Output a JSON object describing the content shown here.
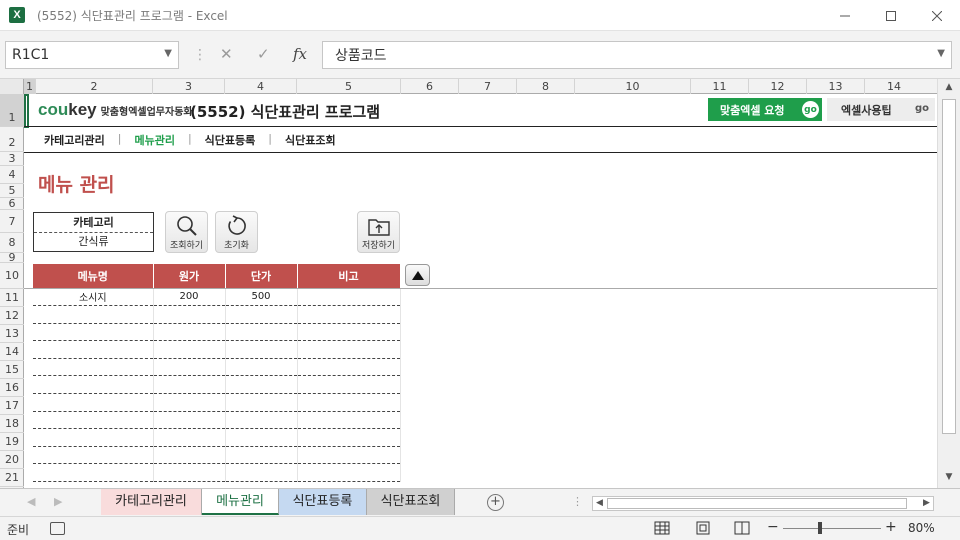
{
  "window": {
    "title": "(5552) 식단표관리 프로그램 - Excel",
    "app_icon_letter": "X"
  },
  "formula_bar": {
    "name_box": "R1C1",
    "fx_label": "fx",
    "formula": "상품코드"
  },
  "columns": [
    "1",
    "2",
    "3",
    "4",
    "5",
    "6",
    "7",
    "8",
    "10",
    "11",
    "12",
    "13",
    "14"
  ],
  "rows": [
    "1",
    "2",
    "3",
    "4",
    "5",
    "6",
    "7",
    "8",
    "9",
    "10",
    "11",
    "12",
    "13",
    "14",
    "15",
    "16",
    "17",
    "18",
    "19",
    "20",
    "21"
  ],
  "header": {
    "brand_logo_a": "cou",
    "brand_logo_b": "key",
    "brand_tagline": "맞춤형엑셀업무자동화",
    "title": "(5552) 식단표관리 프로그램",
    "request_button": "맞춤엑셀 요청",
    "tips_button": "엑셀사용팁",
    "go_label": "go"
  },
  "nav": {
    "items": [
      "카테고리관리",
      "메뉴관리",
      "식단표등록",
      "식단표조회"
    ],
    "separator": "|"
  },
  "page": {
    "title": "메뉴 관리",
    "category_label": "카테고리",
    "category_value": "간식류",
    "search_button": "조회하기",
    "reset_button": "초기화",
    "save_button": "저장하기"
  },
  "table": {
    "headers": [
      "메뉴명",
      "원가",
      "단가",
      "비고"
    ],
    "rows": [
      [
        "소시지",
        "200",
        "500",
        ""
      ]
    ]
  },
  "sheet_tabs": [
    "카테고리관리",
    "메뉴관리",
    "식단표등록",
    "식단표조회"
  ],
  "status": {
    "ready": "준비",
    "zoom": "80%"
  },
  "colors": {
    "accent_red": "#c0504d",
    "excel_green": "#1e7145",
    "button_green": "#1f9e4b"
  }
}
